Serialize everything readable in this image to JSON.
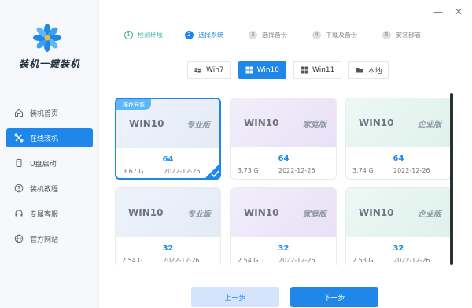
{
  "app": {
    "brand": "装机一键装机",
    "colors": {
      "accent": "#1f86ea",
      "done": "#3cb39b",
      "badge": "#5fb8f5"
    }
  },
  "window": {
    "minimize": "—",
    "close": "✕"
  },
  "sidebar": {
    "items": [
      {
        "label": "装机首页",
        "icon": "home-icon",
        "active": false
      },
      {
        "label": "在线装机",
        "icon": "online-install-icon",
        "active": true
      },
      {
        "label": "U盘启动",
        "icon": "usb-icon",
        "active": false
      },
      {
        "label": "装机教程",
        "icon": "help-icon",
        "active": false
      },
      {
        "label": "专属客服",
        "icon": "headset-icon",
        "active": false
      },
      {
        "label": "官方网站",
        "icon": "globe-icon",
        "active": false
      }
    ]
  },
  "stepper": {
    "steps": [
      {
        "num": "1",
        "label": "检测环境",
        "state": "done"
      },
      {
        "num": "2",
        "label": "选择系统",
        "state": "current"
      },
      {
        "num": "3",
        "label": "选择备份",
        "state": "todo"
      },
      {
        "num": "4",
        "label": "下载及备份",
        "state": "todo"
      },
      {
        "num": "5",
        "label": "安装部署",
        "state": "todo"
      }
    ]
  },
  "tabs": [
    {
      "label": "Win7",
      "icon": "win7-icon",
      "active": false
    },
    {
      "label": "Win10",
      "icon": "windows-icon",
      "active": true
    },
    {
      "label": "Win11",
      "icon": "windows-icon",
      "active": false
    },
    {
      "label": "本地",
      "icon": "folder-icon",
      "active": false
    }
  ],
  "cards": [
    {
      "os": "WIN10",
      "edition": "专业版",
      "bits": "64",
      "size": "3.67 G",
      "date": "2022-12-26",
      "badge": "推荐安装",
      "selected": true,
      "theme": "pro"
    },
    {
      "os": "WIN10",
      "edition": "家庭版",
      "bits": "64",
      "size": "3.73 G",
      "date": "2022-12-26",
      "badge": "",
      "selected": false,
      "theme": "home"
    },
    {
      "os": "WIN10",
      "edition": "企业版",
      "bits": "64",
      "size": "3.74 G",
      "date": "2022-12-26",
      "badge": "",
      "selected": false,
      "theme": "ent"
    },
    {
      "os": "WIN10",
      "edition": "专业版",
      "bits": "32",
      "size": "2.54 G",
      "date": "2022-12-26",
      "badge": "",
      "selected": false,
      "theme": "pro"
    },
    {
      "os": "WIN10",
      "edition": "家庭版",
      "bits": "32",
      "size": "2.54 G",
      "date": "2022-12-26",
      "badge": "",
      "selected": false,
      "theme": "home"
    },
    {
      "os": "WIN10",
      "edition": "企业版",
      "bits": "32",
      "size": "2.53 G",
      "date": "2022-12-26",
      "badge": "",
      "selected": false,
      "theme": "ent"
    }
  ],
  "footer": {
    "prev_label": "上一步",
    "next_label": "下一步"
  }
}
